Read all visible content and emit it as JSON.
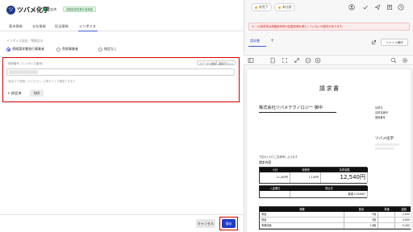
{
  "header": {
    "logo_letter": "ツ",
    "company": "ツバメ化学",
    "status": "探会済",
    "badge": "前期請求書発行済承認"
  },
  "tabs": [
    {
      "label": "基本情報",
      "active": false
    },
    {
      "label": "支払情報",
      "active": false
    },
    {
      "label": "担当情報",
      "active": false
    },
    {
      "label": "インボイス",
      "active": true
    }
  ],
  "invoice_section": {
    "label": "インボイス対応／免税区分",
    "radios": [
      {
        "label": "適格請求書発行事業者",
        "checked": true
      },
      {
        "label": "免税事業者",
        "checked": false
      },
      {
        "label": "指定なし",
        "checked": false
      }
    ],
    "number_label": "登録番号（インボイス番号）",
    "chips": [
      "ステータス確認",
      "国税庁サイト"
    ],
    "hint": "T始まりで登録してください／公表サイトで確認できます",
    "add_label": "+ 探会済",
    "delete_label": "削除"
  },
  "footer": {
    "cancel_label": "キャンセル",
    "save_label": "保存"
  },
  "right_header": {
    "pill_1": "未完了",
    "pill_2": "未仕訳"
  },
  "alert": {
    "text": "※ この請求書は適格請求書の記載事項を満たしていない可能性があります。"
  },
  "doc_tab": {
    "label": "請求書",
    "action_label": "ファイル操作"
  },
  "invoice_doc": {
    "title": "請求書",
    "to": "株式会社ツバメテクノロジー 御中",
    "meta": [
      "請求日",
      "請求書番号",
      "登録番号"
    ],
    "from": "ツバメ化学",
    "greeting": "下記のとおりご請求申し上げます",
    "section": "請求内容",
    "summary_headers": [
      "小計",
      "消費税",
      "請求金額"
    ],
    "summary_values": [
      "11,400円",
      "1,140円",
      "12,540円"
    ],
    "due_headers": [
      "入金期日",
      "振込先"
    ],
    "due_values": [
      "",
      "普通 1234567"
    ],
    "item_headers": [
      "摘要",
      "数量",
      "単価",
      "金額"
    ],
    "items": [
      {
        "name": "商品",
        "qty": "1個",
        "price": "",
        "amount": "2,000"
      },
      {
        "name": "商品",
        "qty": "2個",
        "price": "",
        "amount": "4,000"
      },
      {
        "name": "事務用品",
        "qty": "14個",
        "price": "",
        "amount": "5,400"
      }
    ]
  },
  "icons": {
    "logo": "company-logo",
    "toolbar": [
      "sidebar-toggle-icon",
      "document-icon",
      "fit-icon",
      "expand-icon",
      "zoom-out-icon",
      "zoom-in-icon",
      "search-icon",
      "settings-icon"
    ],
    "top_right": [
      "avatar-icon",
      "check-icon",
      "share-icon",
      "export-icon",
      "comment-icon",
      "history-icon"
    ]
  },
  "colors": {
    "primary": "#1e3cc8",
    "highlight_border": "#d50000",
    "alert_bg": "#fdecec",
    "alert_text": "#c62828",
    "status_green": "#1f9d55"
  }
}
